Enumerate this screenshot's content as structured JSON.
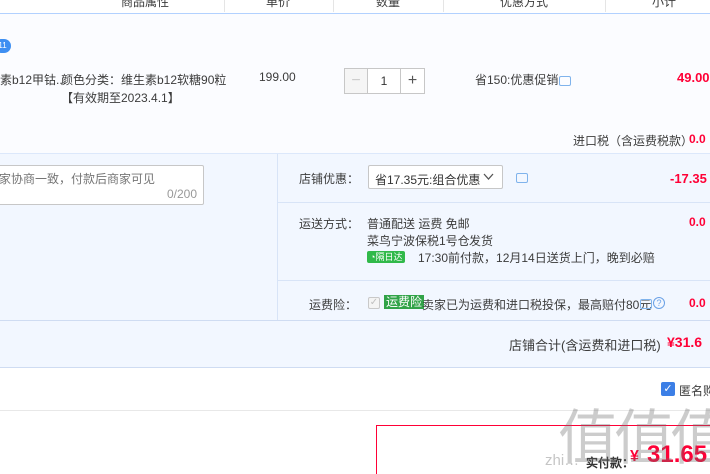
{
  "header": {
    "cols": [
      "商品属性",
      "单价",
      "数量",
      "优惠方式",
      "小计"
    ]
  },
  "item": {
    "name": "素b12甲钴...",
    "attr": "颜色分类：维生素b12软糖90粒",
    "validity": "【有效期至2023.4.1】",
    "unit_price": "199.00",
    "quantity": "1",
    "minus": "−",
    "plus": "+",
    "discount": "省150:优惠促销",
    "subtotal": "49.00",
    "badge": "11"
  },
  "import_tax": {
    "label": "进口税（含运费税款）",
    "value": "0.0"
  },
  "message": {
    "placeholder": "家协商一致，付款后商家可见",
    "count": "0/200"
  },
  "store_discount": {
    "label": "店铺优惠：",
    "selected": "省17.35元:组合优惠",
    "amount": "-17.35"
  },
  "shipping": {
    "label": "运送方式：",
    "method": "普通配送 运费 免邮",
    "warehouse": "菜鸟宁波保税1号仓",
    "ship_text": "发货",
    "tag": "隔日达",
    "eta": "17:30前付款，12月14日送货上门，晚到必赔",
    "fee": "0.0"
  },
  "insurance": {
    "label": "运费险：",
    "tag": "运费险",
    "desc": "卖家已为运费和进口税投保，最高赔付80元",
    "fee": "0.0"
  },
  "store_total": {
    "label": "店铺合计(含运费和进口税)",
    "value": "¥31.6"
  },
  "anonymous": {
    "label": "匿名购"
  },
  "pay": {
    "label": "实付款：",
    "symbol": "¥",
    "value": "31.65"
  },
  "watermark": {
    "main": "值值值",
    "site": "zhi…"
  },
  "colors": {
    "accent_red": "#ff0036",
    "accent_blue": "#3e8ff2",
    "panel_bg": "#f2f7ff"
  }
}
